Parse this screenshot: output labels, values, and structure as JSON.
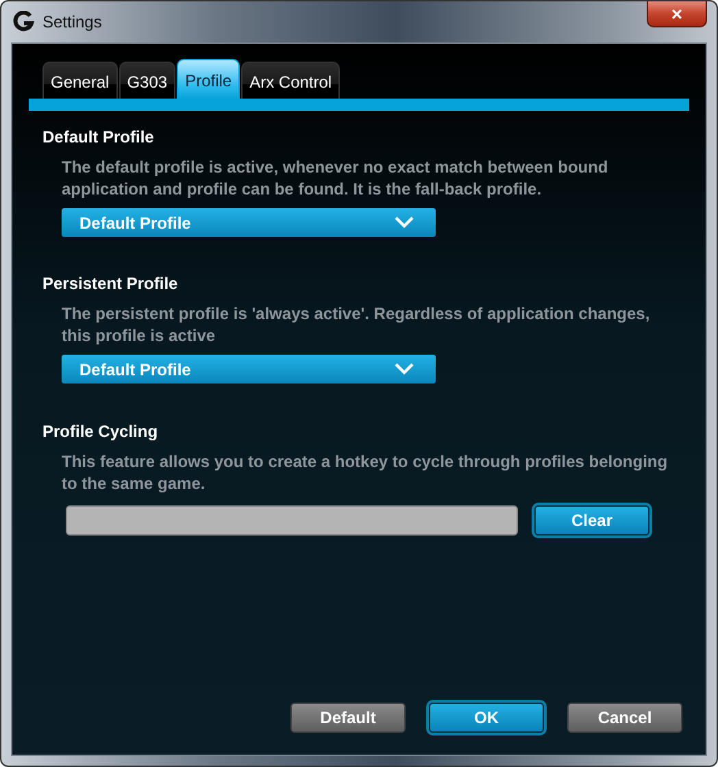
{
  "window": {
    "title": "Settings",
    "close": "×"
  },
  "tabs": [
    {
      "label": "General",
      "selected": false
    },
    {
      "label": "G303",
      "selected": false
    },
    {
      "label": "Profile",
      "selected": true
    },
    {
      "label": "Arx Control",
      "selected": false
    }
  ],
  "sections": [
    {
      "kind": "dropdown",
      "heading": "Default Profile",
      "description": "The default profile is active, whenever no exact match between bound application and profile can be found. It is the fall-back profile.",
      "value": "Default Profile"
    },
    {
      "kind": "dropdown",
      "heading": "Persistent Profile",
      "description": "The persistent profile is 'always active'. Regardless of application changes, this profile is active",
      "value": "Default Profile"
    },
    {
      "kind": "hotkey",
      "heading": "Profile Cycling",
      "description": "This feature allows you to create a hotkey to cycle through profiles belonging to the same game.",
      "button": "Clear"
    }
  ],
  "buttons": [
    {
      "label": "Default",
      "kind": "secondary"
    },
    {
      "label": "OK",
      "kind": "primary"
    },
    {
      "label": "Cancel",
      "kind": "secondary"
    }
  ]
}
